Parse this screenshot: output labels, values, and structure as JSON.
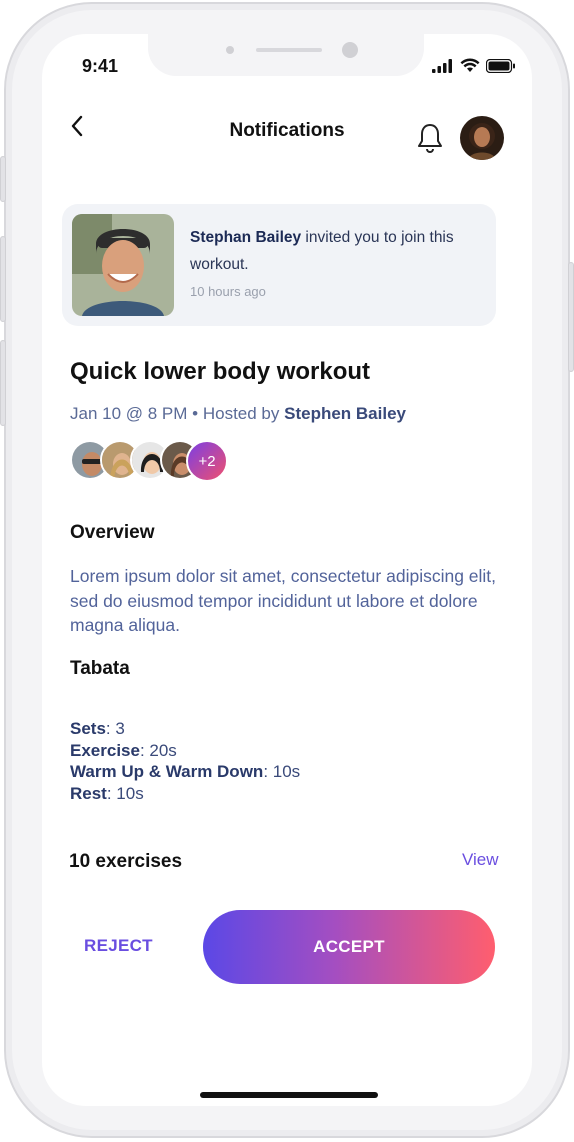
{
  "status_bar": {
    "time": "9:41"
  },
  "header": {
    "title": "Notifications"
  },
  "invite": {
    "inviter_name": "Stephan Bailey",
    "message": " invited you to join this workout.",
    "time_ago": "10 hours ago"
  },
  "event": {
    "title": "Quick lower body workout",
    "when": "Jan 10 @ 8 PM",
    "separator": " • Hosted by ",
    "host": "Stephen Bailey",
    "more_participants": "+2"
  },
  "overview": {
    "heading": "Overview",
    "text": "Lorem ipsum dolor sit amet, consectetur adipiscing elit, sed do eiusmod tempor incididunt ut labore et dolore magna aliqua."
  },
  "tabata": {
    "heading": "Tabata",
    "specs": [
      {
        "label": "Sets",
        "value": ": 3"
      },
      {
        "label": "Exercise",
        "value": ": 20s"
      },
      {
        "label": "Warm Up & Warm Down",
        "value": ": 10s"
      },
      {
        "label": "Rest",
        "value": ": 10s"
      }
    ]
  },
  "exercises": {
    "heading": "10 exercises",
    "view_label": "View"
  },
  "actions": {
    "reject_label": "REJECT",
    "accept_label": "ACCEPT"
  },
  "colors": {
    "accent": "#6a4ee0",
    "gradient_start": "#5b48e6",
    "gradient_end": "#ff5e6e"
  }
}
